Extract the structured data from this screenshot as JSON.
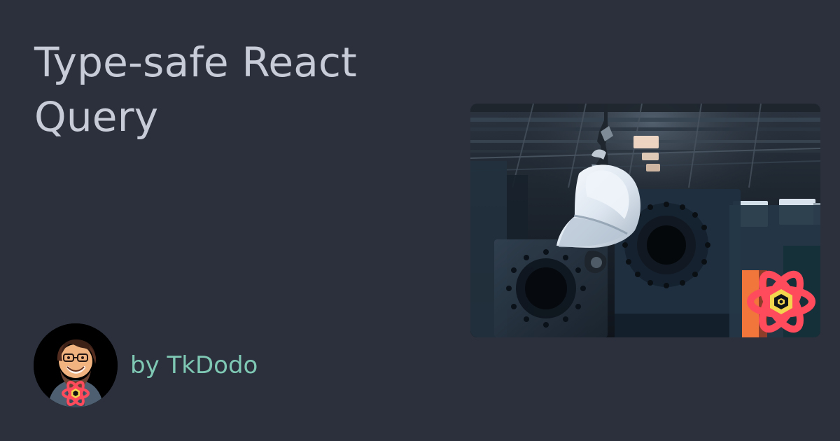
{
  "post": {
    "title": "Type-safe React Query",
    "author": "by TkDodo"
  },
  "images": {
    "hero": "hard-hat-photo",
    "avatar": "author-photo"
  },
  "colors": {
    "background": "#2b303c",
    "title": "#c7ccd8",
    "author": "#7fc8b4",
    "accent": "#ff4b5c"
  }
}
